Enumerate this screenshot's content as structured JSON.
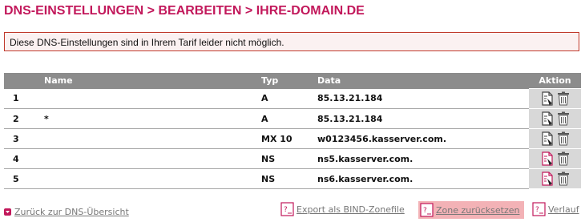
{
  "page": {
    "title": "DNS-EINSTELLUNGEN > BEARBEITEN > IHRE-DOMAIN.DE"
  },
  "alert": {
    "message": "Diese DNS-Einstellungen sind in Ihrem Tarif leider nicht möglich."
  },
  "table": {
    "headers": {
      "num": "",
      "name": "Name",
      "typ": "Typ",
      "data": "Data",
      "action": "Aktion"
    },
    "rows": [
      {
        "num": "1",
        "name": "",
        "typ": "A",
        "data": "85.13.21.184",
        "edit_icon": "edit-icon",
        "delete_icon": "trash-icon"
      },
      {
        "num": "2",
        "name": "*",
        "typ": "A",
        "data": "85.13.21.184",
        "edit_icon": "edit-icon",
        "delete_icon": "trash-icon"
      },
      {
        "num": "3",
        "name": "",
        "typ": "MX 10",
        "data": "w0123456.kasserver.com.",
        "edit_icon": "edit-icon",
        "delete_icon": "trash-icon"
      },
      {
        "num": "4",
        "name": "",
        "typ": "NS",
        "data": "ns5.kasserver.com.",
        "edit_icon": "edit-red-icon",
        "delete_icon": "trash-icon"
      },
      {
        "num": "5",
        "name": "",
        "typ": "NS",
        "data": "ns6.kasserver.com.",
        "edit_icon": "edit-red-icon",
        "delete_icon": "trash-icon"
      }
    ]
  },
  "footer": {
    "back_label": "Zurück zur DNS-Übersicht",
    "export_label": "Export als BIND-Zonefile",
    "reset_label": "Zone zurücksetzen",
    "history_label": "Verlauf"
  },
  "colors": {
    "accent": "#c2185b",
    "header_bg": "#8c8c8c",
    "alert_border": "#c0392b",
    "reset_highlight": "#f3b2b6"
  }
}
